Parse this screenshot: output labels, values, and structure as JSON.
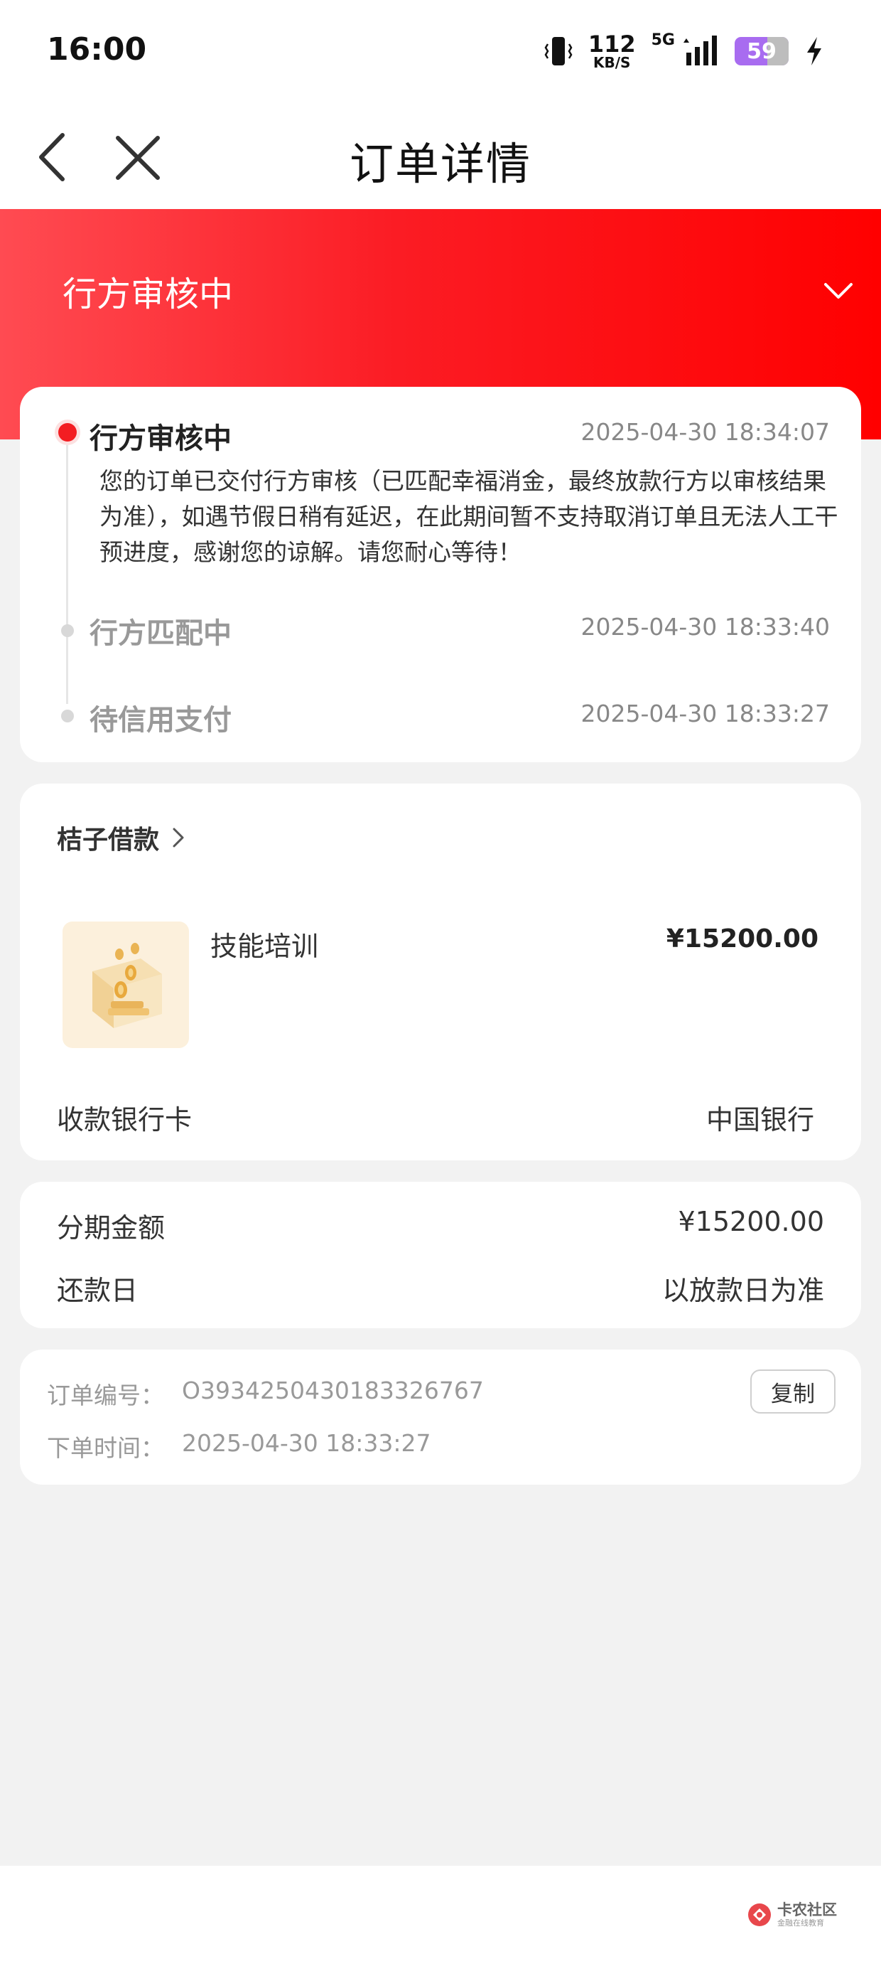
{
  "status_bar": {
    "time": "16:00",
    "speed_value": "112",
    "speed_unit": "KB/S",
    "network": "5G",
    "battery": "59"
  },
  "nav": {
    "title": "订单详情"
  },
  "banner": {
    "status": "行方审核中"
  },
  "timeline": [
    {
      "title": "行方审核中",
      "time": "2025-04-30 18:34:07",
      "description": "您的订单已交付行方审核（已匹配幸福消金，最终放款行方以审核结果为准），如遇节假日稍有延迟，在此期间暂不支持取消订单且无法人工干预进度，感谢您的谅解。请您耐心等待！",
      "active": true
    },
    {
      "title": "行方匹配中",
      "time": "2025-04-30 18:33:40",
      "active": false
    },
    {
      "title": "待信用支付",
      "time": "2025-04-30 18:33:27",
      "active": false
    }
  ],
  "product": {
    "merchant": "桔子借款",
    "name": "技能培训",
    "price": "¥15200.00",
    "bank_label": "收款银行卡",
    "bank_value": "中国银行"
  },
  "installment": {
    "amount_label": "分期金额",
    "amount_value": "¥15200.00",
    "repay_label": "还款日",
    "repay_value": "以放款日为准"
  },
  "order": {
    "number_label": "订单编号：",
    "number_value": "O3934250430183326767",
    "time_label": "下单时间：",
    "time_value": "2025-04-30 18:33:27",
    "copy_label": "复制"
  },
  "watermark": {
    "title": "卡农社区",
    "subtitle": "金融在线教育"
  },
  "colors": {
    "brand_red": "#f31d22",
    "banner_gradient_start": "#ff4b52",
    "banner_gradient_end": "#ff0000",
    "battery": "#a86cf0"
  }
}
